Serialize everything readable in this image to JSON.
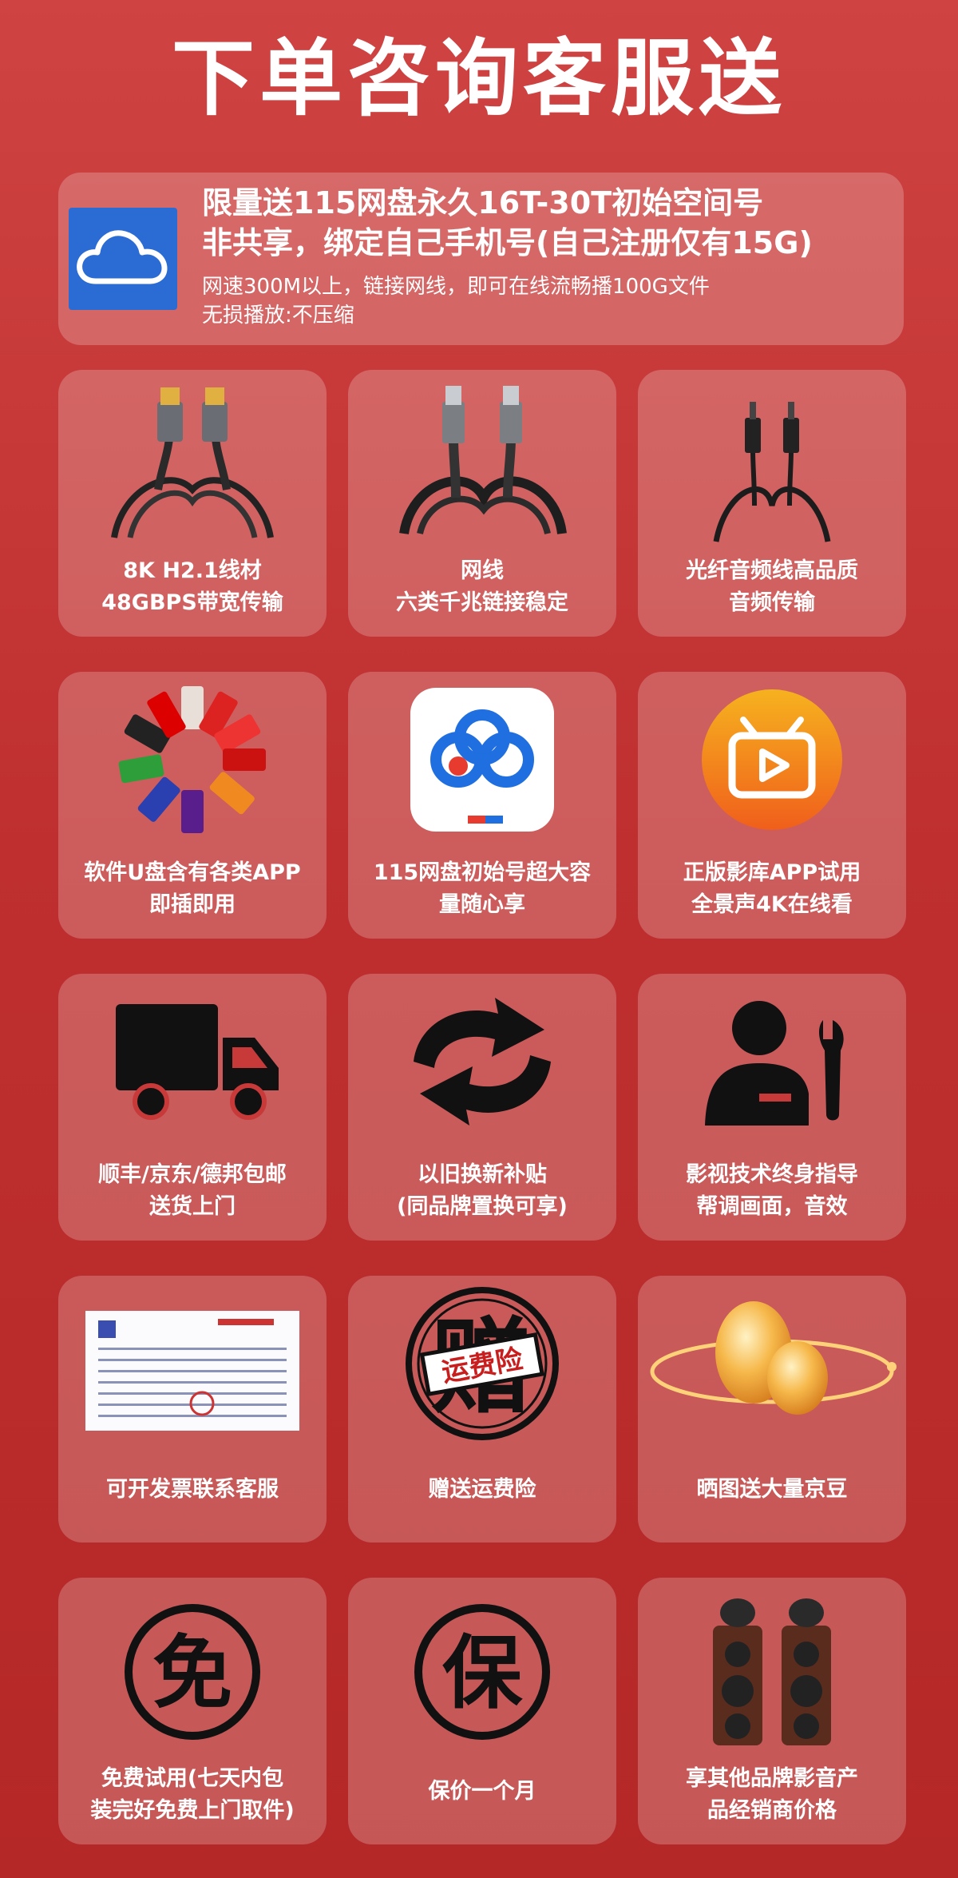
{
  "title": "下单咨询客服送",
  "banner": {
    "line1": "限量送115网盘永久16T-30T初始空间号",
    "line2": "非共享，绑定自己手机号(自己注册仅有15G)",
    "line3": "网速300M以上，链接网线，即可在线流畅播100G文件",
    "line4": "无损播放:不压缩",
    "logo_icon": "cloud-icon",
    "logo_color": "#2a6bd4"
  },
  "cards": [
    {
      "icon": "hdmi-cable-icon",
      "lines": [
        "8K  H2.1线材",
        "48GBPS带宽传输"
      ]
    },
    {
      "icon": "network-cable-icon",
      "lines": [
        "网线",
        "六类千兆链接稳定"
      ]
    },
    {
      "icon": "optical-audio-cable-icon",
      "lines": [
        "光纤音频线高品质",
        "音频传输"
      ]
    },
    {
      "icon": "usb-drives-icon",
      "lines": [
        "软件U盘含有各类APP",
        "即插即用"
      ]
    },
    {
      "icon": "baidu-netdisk-app-icon",
      "lines": [
        "115网盘初始号超大容",
        "量随心享"
      ]
    },
    {
      "icon": "tv-app-icon",
      "lines": [
        "正版影库APP试用",
        "全景声4K在线看"
      ]
    },
    {
      "icon": "delivery-truck-icon",
      "lines": [
        "顺丰/京东/德邦包邮",
        "送货上门"
      ]
    },
    {
      "icon": "exchange-arrows-icon",
      "lines": [
        "以旧换新补贴",
        "(同品牌置换可享)"
      ]
    },
    {
      "icon": "technician-wrench-icon",
      "lines": [
        "影视技术终身指导",
        "帮调画面，音效"
      ]
    },
    {
      "icon": "invoice-icon",
      "lines": [
        "可开发票联系客服"
      ]
    },
    {
      "icon": "shipping-insurance-stamp-icon",
      "lines": [
        "赠送运费险"
      ],
      "stamp_text": "运费险",
      "stamp_big": "赠"
    },
    {
      "icon": "gold-bean-icon",
      "lines": [
        "晒图送大量京豆"
      ]
    },
    {
      "icon": "free-circle-icon",
      "lines": [
        "免费试用(七天内包",
        "装完好免费上门取件)"
      ],
      "glyph": "免"
    },
    {
      "icon": "guarantee-circle-icon",
      "lines": [
        "保价一个月"
      ],
      "glyph": "保"
    },
    {
      "icon": "speakers-icon",
      "lines": [
        "享其他品牌影音产",
        "品经销商价格"
      ]
    }
  ]
}
